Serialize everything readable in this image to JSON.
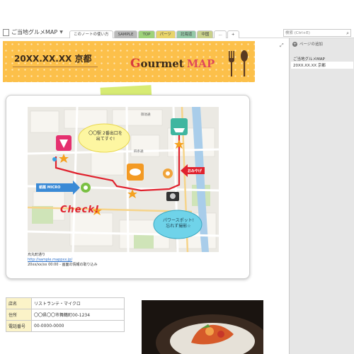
{
  "header": {
    "notebook_title": "ご当地グルメMAP",
    "tabs": [
      {
        "label": "このノートの使い方",
        "color": "#ffffff"
      },
      {
        "label": "SAMPLE",
        "color": "#b9b9b9"
      },
      {
        "label": "TOP",
        "color": "#9ed27a"
      },
      {
        "label": "パーツ",
        "color": "#e8d46a"
      },
      {
        "label": "北海道",
        "color": "#95c9a8"
      },
      {
        "label": "中国",
        "color": "#c9d18b"
      },
      {
        "label": "…",
        "color": "#ffffff"
      },
      {
        "label": "+",
        "color": "#ffffff"
      }
    ],
    "search_placeholder": "検索 (Ctrl+E)"
  },
  "page_pane": {
    "add_page_label": "ページの追加",
    "pages": [
      "ご当地グルメMAP",
      "20XX.XX.XX 京都"
    ]
  },
  "banner": {
    "title": "20XX.XX.XX 京都",
    "logo_initial": "G",
    "logo_word": "ourmet",
    "logo_map": "MAP",
    "color": "#fcc04a"
  },
  "map": {
    "bubble_top": "〇〇駅 2番出口を\n出てすぐ!",
    "bubble_bottom": "パワースポット!\n忘れず撮影☆",
    "check_label": "Check!",
    "pin_label": "○○寺 黒田",
    "station_label": "蛸薬 MICRO",
    "osusume_label": "おみやげ",
    "route_color": "#e0222e",
    "street_labels": [
      "河原町通",
      "四条通",
      "寺町通",
      "木屋町通",
      "御池通",
      "烏丸通"
    ],
    "credit_line1": "烏丸町通り",
    "credit_link": "http://sample.mappxx.jp/",
    "credit_line2": "20xx/xx/xx 00:00 - 画面の情報の取り込み"
  },
  "info": {
    "rows": [
      {
        "key": "店名",
        "value": "リストランテ・マイクロ"
      },
      {
        "key": "住所",
        "value": "〇〇県〇〇市舞鶴町00-1234"
      },
      {
        "key": "電話番号",
        "value": "00-0000-0000"
      }
    ]
  }
}
